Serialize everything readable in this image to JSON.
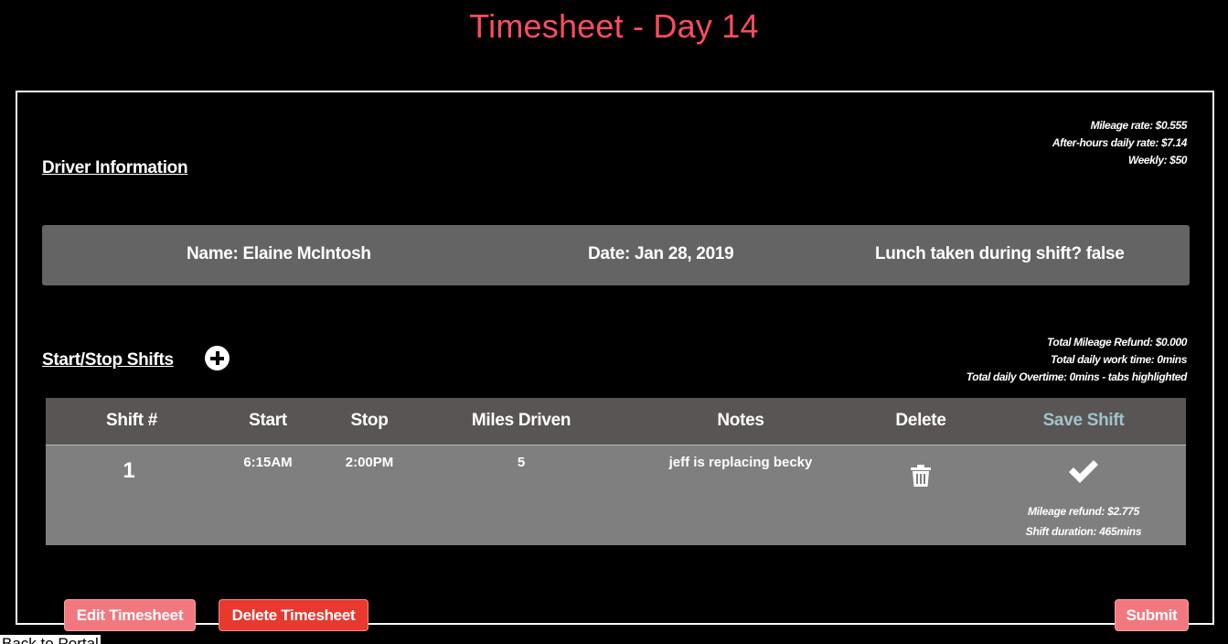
{
  "page": {
    "title": "Timesheet - Day 14"
  },
  "rates": {
    "mileage": "Mileage rate: $0.555",
    "after_hours": "After-hours daily rate: $7.14",
    "weekly": "Weekly: $50"
  },
  "driver": {
    "heading": "Driver Information",
    "name": "Name: Elaine McIntosh",
    "date": "Date: Jan 28, 2019",
    "lunch": "Lunch taken during shift? false"
  },
  "shifts": {
    "heading": "Start/Stop Shifts",
    "add_icon": "plus-circle-icon",
    "totals": {
      "mileage_refund": "Total Mileage Refund: $0.000",
      "work_time": "Total daily work time: 0mins",
      "overtime": "Total daily Overtime: 0mins - tabs highlighted"
    },
    "columns": {
      "shift": "Shift #",
      "start": "Start",
      "stop": "Stop",
      "miles": "Miles Driven",
      "notes": "Notes",
      "delete": "Delete",
      "save": "Save Shift"
    },
    "rows": [
      {
        "shift": "1",
        "start": "6:15AM",
        "stop": "2:00PM",
        "miles": "5",
        "notes": "jeff is replacing becky",
        "delete_icon": "trash-icon",
        "save_icon": "checkmark-icon",
        "mileage_refund": "Mileage refund: $2.775",
        "duration": "Shift duration: 465mins"
      }
    ]
  },
  "actions": {
    "edit": "Edit Timesheet",
    "delete": "Delete Timesheet",
    "submit": "Submit",
    "back": "Back to Portal"
  },
  "colors": {
    "title": "#ff4d5e",
    "info_bar": "#646464",
    "table_header": "#5a5555",
    "table_body": "#7f7f7f",
    "save_header": "#9fc4cc",
    "button_pink": "#f2787f",
    "button_red": "#e8392f"
  }
}
